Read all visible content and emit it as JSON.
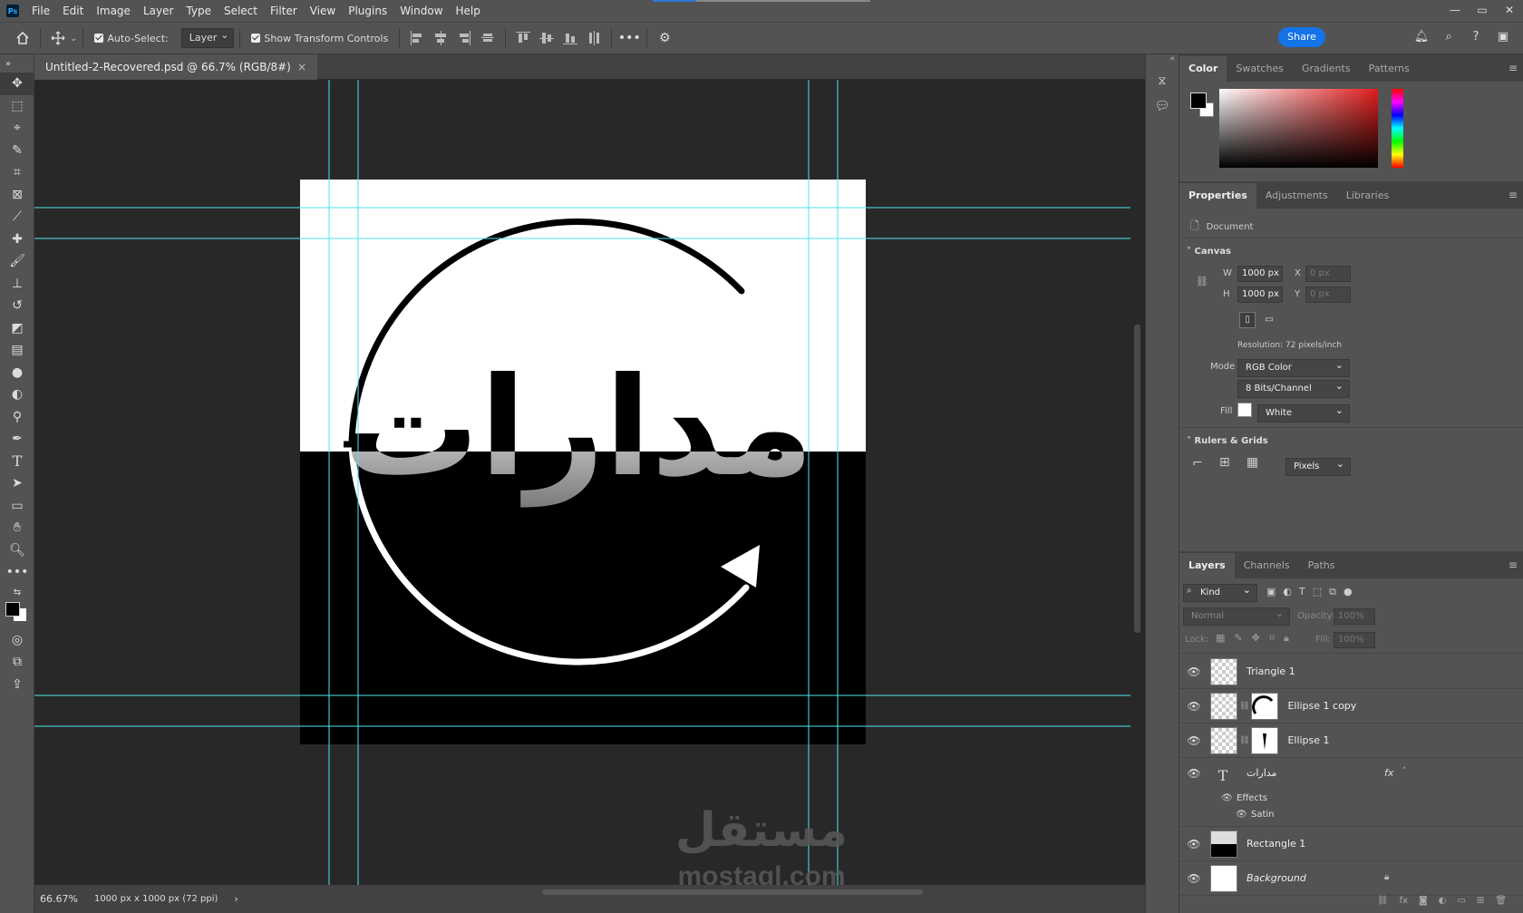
{
  "app": {
    "logo": "Ps"
  },
  "menu": [
    "File",
    "Edit",
    "Image",
    "Layer",
    "Type",
    "Select",
    "Filter",
    "View",
    "Plugins",
    "Window",
    "Help"
  ],
  "window_controls": [
    "—",
    "▭",
    "✕"
  ],
  "options": {
    "auto_select_label": "Auto-Select:",
    "auto_select_value": "Layer",
    "transform_label": "Show Transform Controls",
    "share_label": "Share"
  },
  "document": {
    "tab_title": "Untitled-2-Recovered.psd @ 66.7% (RGB/8#)",
    "close": "×",
    "artwork_text": "مدارات",
    "watermark_arabic": "مستقل",
    "watermark_latin": "mostaql.com"
  },
  "status": {
    "zoom": "66.67%",
    "doc_info": "1000 px x 1000 px (72 ppi)",
    "arrow": "›"
  },
  "color_panel": {
    "tabs": [
      "Color",
      "Swatches",
      "Gradients",
      "Patterns"
    ],
    "foreground": "#000000",
    "background": "#ffffff"
  },
  "properties_panel": {
    "tabs": [
      "Properties",
      "Adjustments",
      "Libraries"
    ],
    "doc_label": "Document",
    "canvas_section": "Canvas",
    "w_label": "W",
    "w_value": "1000 px",
    "h_label": "H",
    "h_value": "1000 px",
    "x_label": "X",
    "x_value": "0 px",
    "y_label": "Y",
    "y_value": "0 px",
    "resolution": "Resolution: 72 pixels/inch",
    "mode_label": "Mode",
    "mode_value": "RGB Color",
    "bits_value": "8 Bits/Channel",
    "fill_label": "Fill",
    "fill_value": "White",
    "rulers_section": "Rulers & Grids",
    "units_value": "Pixels"
  },
  "layers_panel": {
    "tabs": [
      "Layers",
      "Channels",
      "Paths"
    ],
    "filter_kind": "Kind",
    "blend_mode": "Normal",
    "opacity_label": "Opacity:",
    "opacity_value": "100%",
    "lock_label": "Lock:",
    "fill_label": "Fill:",
    "fill_value": "100%",
    "layers": [
      {
        "name": "Triangle 1"
      },
      {
        "name": "Ellipse 1 copy"
      },
      {
        "name": "Ellipse 1"
      },
      {
        "name": "مدارات",
        "fx": "fx",
        "effects_label": "Effects",
        "effect": "Satin"
      },
      {
        "name": "Rectangle 1"
      },
      {
        "name": "Background"
      }
    ]
  }
}
